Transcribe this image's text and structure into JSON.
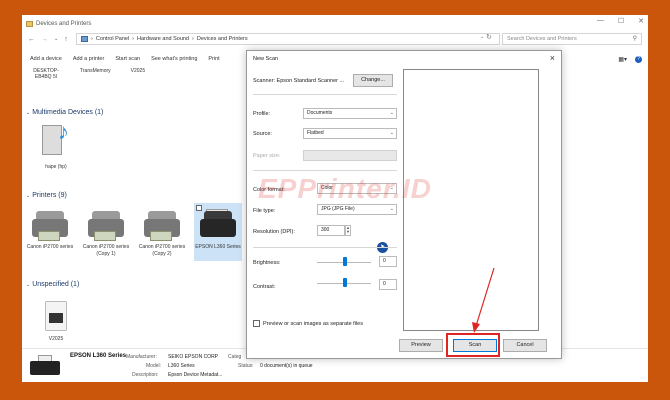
{
  "window": {
    "title": "Devices and Printers",
    "controls": [
      "—",
      "☐",
      "✕"
    ]
  },
  "address": {
    "path": [
      "Control Panel",
      "Hardware and Sound",
      "Devices and Printers"
    ],
    "search_placeholder": "Search Devices and Printers"
  },
  "toolbar": {
    "items": [
      "Add a device",
      "Add a printer",
      "Start scan",
      "See what's printing",
      "Print"
    ]
  },
  "devices": {
    "top_items": [
      "DESKTOP-EB4BQ 5I",
      "TransMemory",
      "V2025"
    ],
    "sections": {
      "multimedia": "Multimedia Devices (1)",
      "printers": "Printers (9)",
      "unspecified": "Unspecified (1)"
    },
    "multimedia_items": [
      {
        "label": "hape (hp)"
      }
    ],
    "printer_items": [
      {
        "label": "Canon iP2700 series"
      },
      {
        "label": "Canon iP2700 series (Copy 1)"
      },
      {
        "label": "Canon iP2700 series (Copy 2)"
      },
      {
        "label": "EPSON L360 Series"
      }
    ],
    "unspecified_items": [
      {
        "label": "V2025"
      }
    ]
  },
  "details": {
    "name": "EPSON L360 Series",
    "manufacturer_label": "Manufacturer:",
    "manufacturer": "SEIKO EPSON CORP",
    "model_label": "Model:",
    "model": "L360 Series",
    "description_label": "Description:",
    "description": "Epson Device Metadat...",
    "category_label": "Categ",
    "status_label": "Status:",
    "status": "0 document(s) in queue"
  },
  "scan_dialog": {
    "title": "New Scan",
    "scanner_label": "Scanner: Epson Standard Scanner ...",
    "change_button": "Change...",
    "profile_label": "Profile:",
    "profile_value": "Documents",
    "source_label": "Source:",
    "source_value": "Flatbed",
    "paper_size_label": "Paper size:",
    "color_format_label": "Color format:",
    "color_format_value": "Color",
    "file_type_label": "File type:",
    "file_type_value": "JPG (JPG File)",
    "resolution_label": "Resolution (DPI):",
    "resolution_value": "300",
    "brightness_label": "Brightness:",
    "brightness_value": "0",
    "contrast_label": "Contrast:",
    "contrast_value": "0",
    "separate_files_label": "Preview or scan images as separate files",
    "preview_button": "Preview",
    "scan_button": "Scan",
    "cancel_button": "Cancel"
  },
  "watermark": "EPPrinter.ID",
  "colors": {
    "frame": "#c9560b",
    "highlight": "#e02424",
    "slider_accent": "#0078d7"
  }
}
